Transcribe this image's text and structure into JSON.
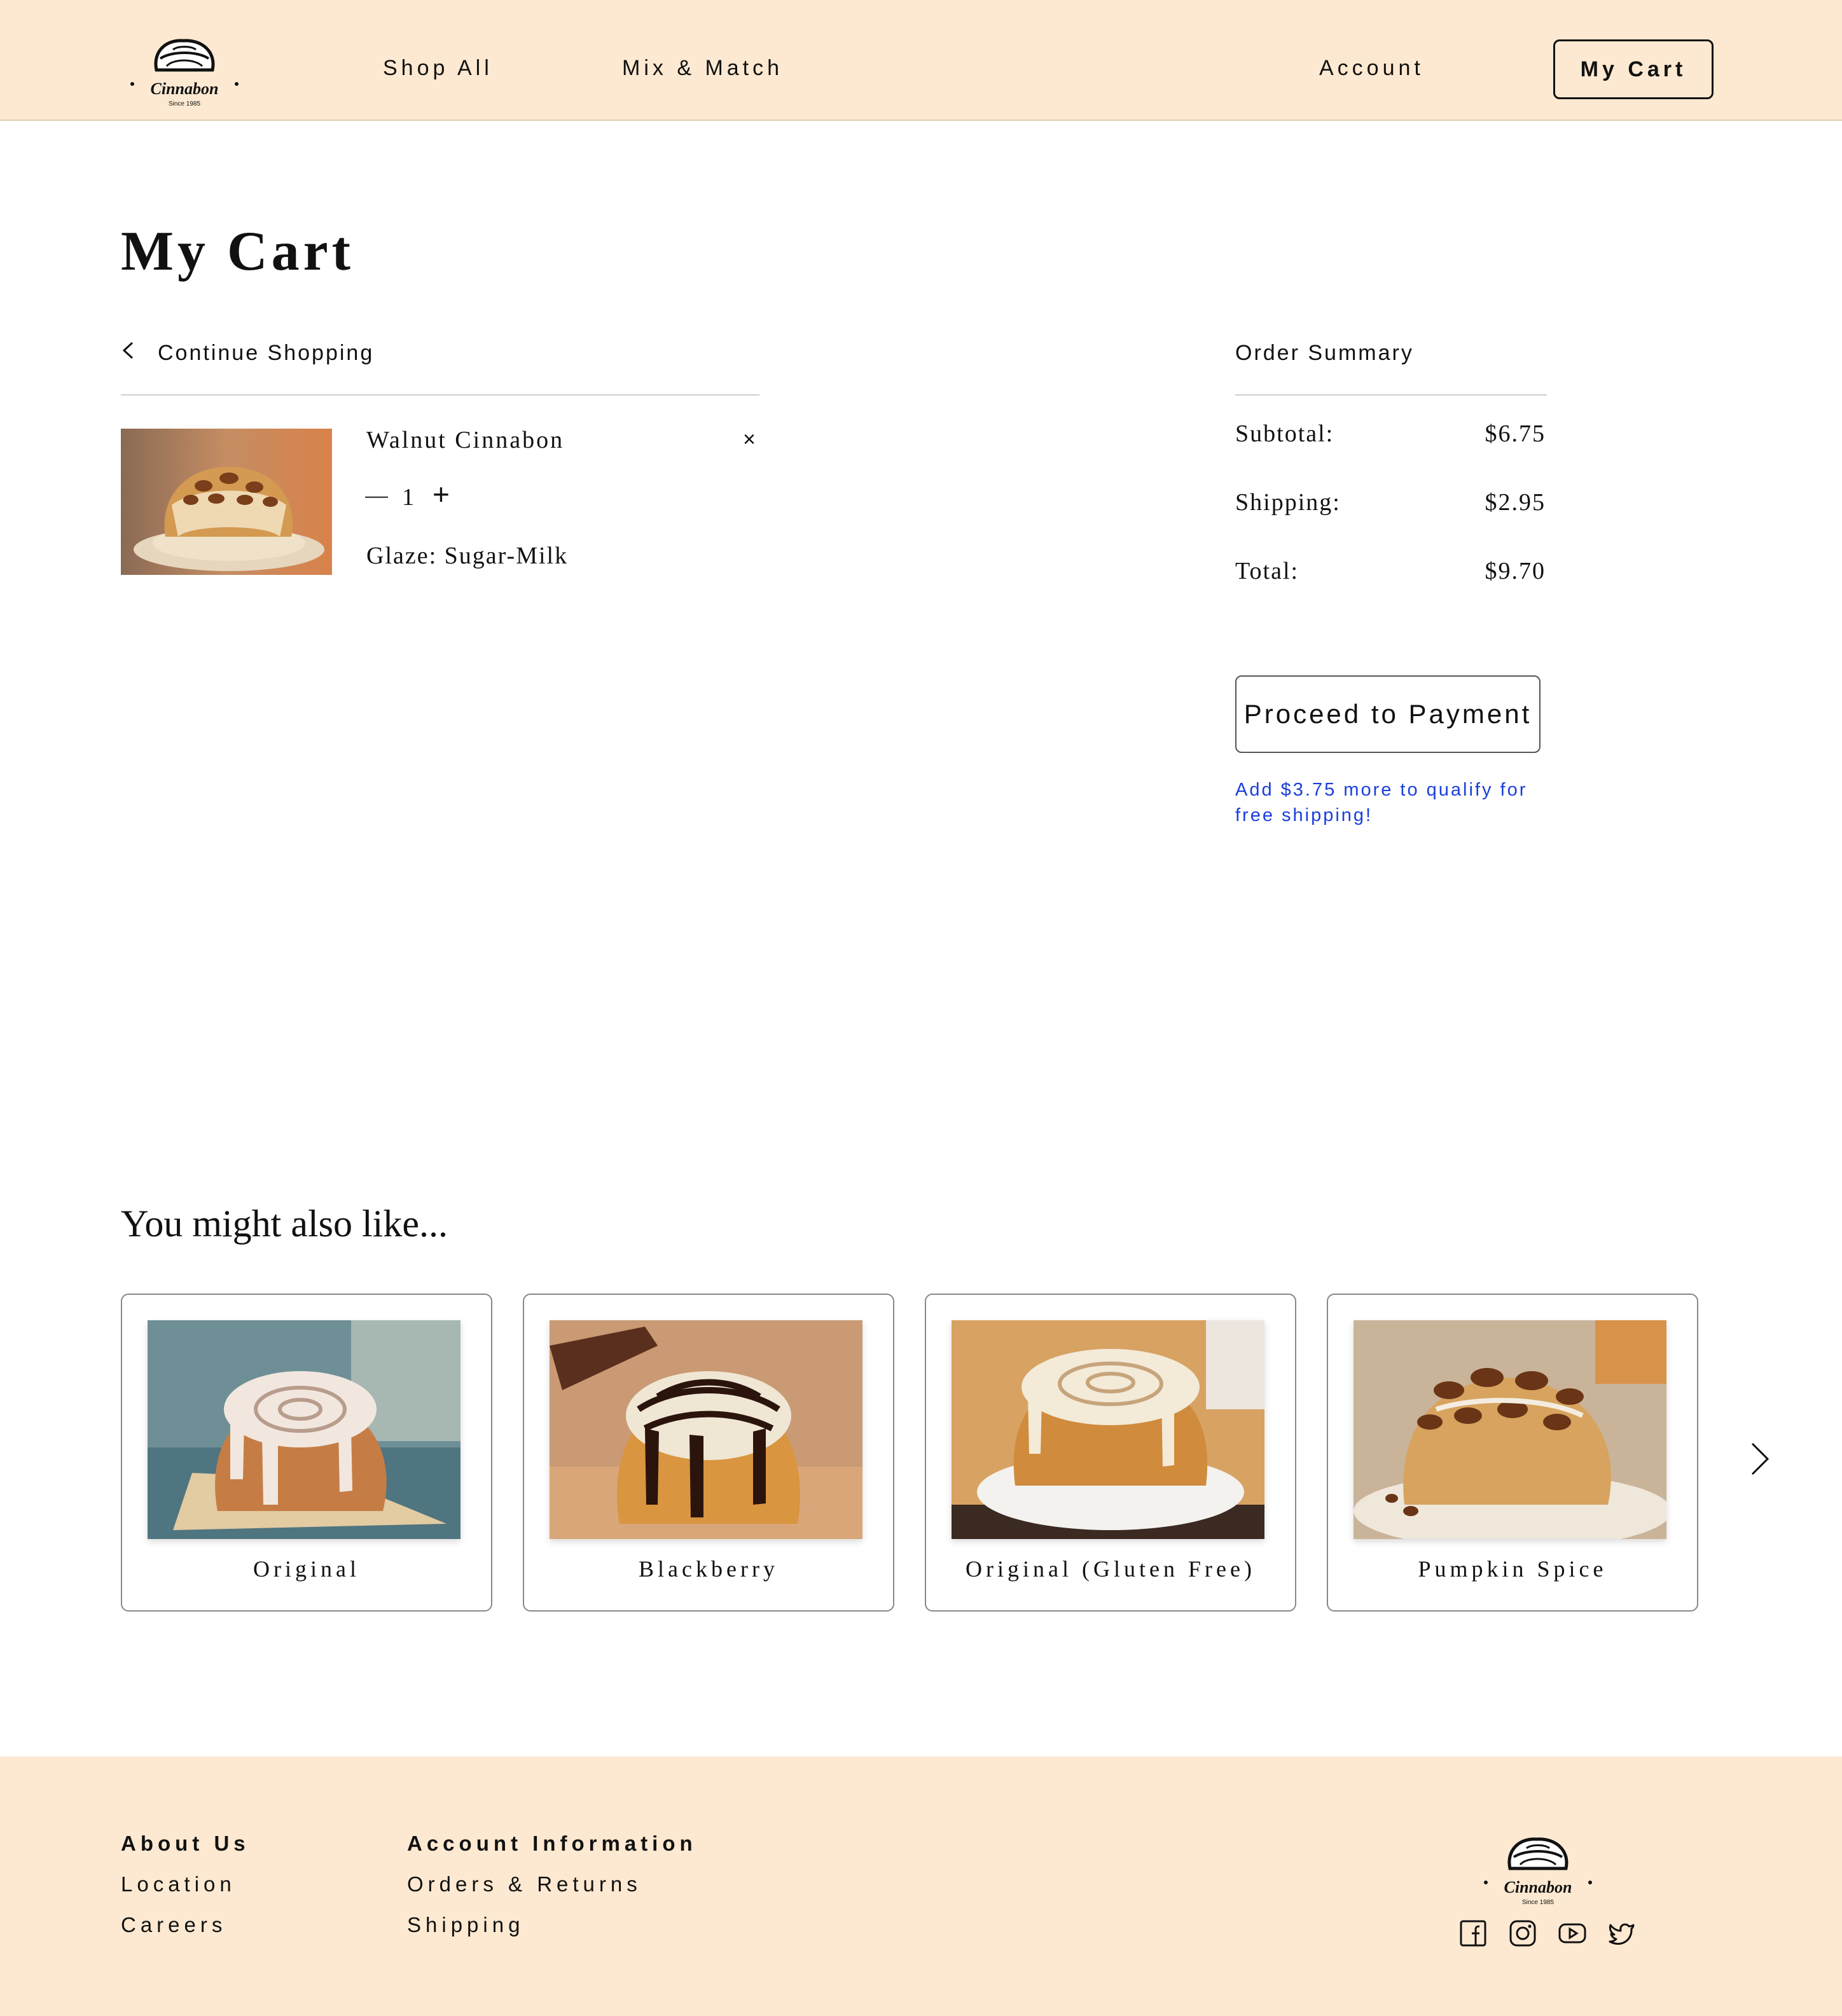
{
  "header": {
    "logo_text": "Cinnabon",
    "logo_subtext": "Since 1985",
    "nav": [
      "Shop All",
      "Mix & Match"
    ],
    "account_label": "Account",
    "cart_label": "My Cart"
  },
  "cart": {
    "title": "My Cart",
    "continue_label": "Continue Shopping",
    "item": {
      "name": "Walnut Cinnabon",
      "remove_glyph": "×",
      "qty_minus": "—",
      "quantity": "1",
      "qty_plus": "+",
      "glaze": "Glaze: Sugar-Milk"
    }
  },
  "summary": {
    "title": "Order Summary",
    "rows": [
      {
        "label": "Subtotal:",
        "value": "$6.75"
      },
      {
        "label": "Shipping:",
        "value": "$2.95"
      },
      {
        "label": "Total:",
        "value": "$9.70"
      }
    ],
    "pay_button": "Proceed to Payment",
    "free_shipping_note": "Add $3.75 more to qualify for free shipping!"
  },
  "recommendations": {
    "title": "You might also like...",
    "items": [
      {
        "label": "Original"
      },
      {
        "label": "Blackberry"
      },
      {
        "label": "Original (Gluten Free)"
      },
      {
        "label": "Pumpkin Spice"
      }
    ]
  },
  "footer": {
    "col1": {
      "heading": "About Us",
      "links": [
        "Location",
        "Careers"
      ]
    },
    "col2": {
      "heading": "Account Information",
      "links": [
        "Orders & Returns",
        "Shipping"
      ]
    },
    "social": [
      "facebook-icon",
      "instagram-icon",
      "youtube-icon",
      "twitter-icon"
    ]
  },
  "colors": {
    "header_bg": "#fde9d1",
    "link_blue": "#1a3fdc",
    "text": "#111111"
  }
}
